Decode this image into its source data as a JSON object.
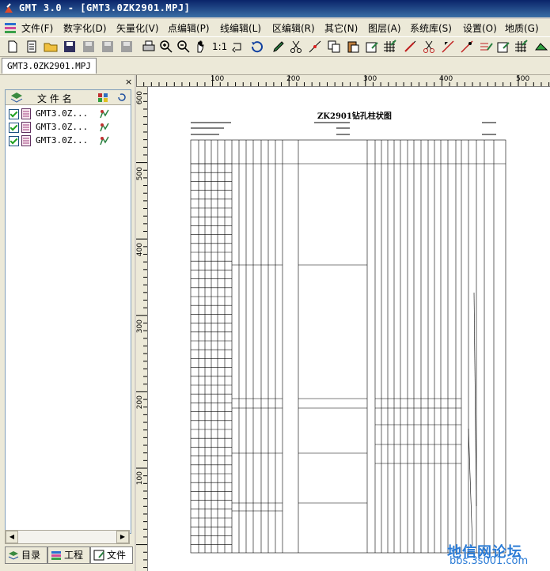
{
  "window": {
    "title": "GMT 3.0 - [GMT3.0ZK2901.MPJ]"
  },
  "menu": [
    "文件(F)",
    "数字化(D)",
    "矢量化(V)",
    "点编辑(P)",
    "线编辑(L)",
    "区编辑(R)",
    "其它(N)",
    "图层(A)",
    "系统库(S)",
    "设置(O)",
    "地质(G)"
  ],
  "toolbar": {
    "scale_label": "1:1"
  },
  "doc_tab": "GMT3.0ZK2901.MPJ",
  "panel": {
    "close": "×",
    "header_label": "文 件 名",
    "files": [
      {
        "name": "GMT3.0Z..."
      },
      {
        "name": "GMT3.0Z..."
      },
      {
        "name": "GMT3.0Z..."
      }
    ],
    "tabs": [
      "目录",
      "工程",
      "文件"
    ]
  },
  "ruler_h": [
    "100",
    "200",
    "300",
    "400",
    "500"
  ],
  "ruler_v": [
    "600",
    "500",
    "400",
    "300",
    "200",
    "100"
  ],
  "drawing": {
    "title": "ZK2901钻孔柱状图"
  },
  "watermark": {
    "text": "地信网论坛",
    "url": "bbs.3s001.com"
  }
}
